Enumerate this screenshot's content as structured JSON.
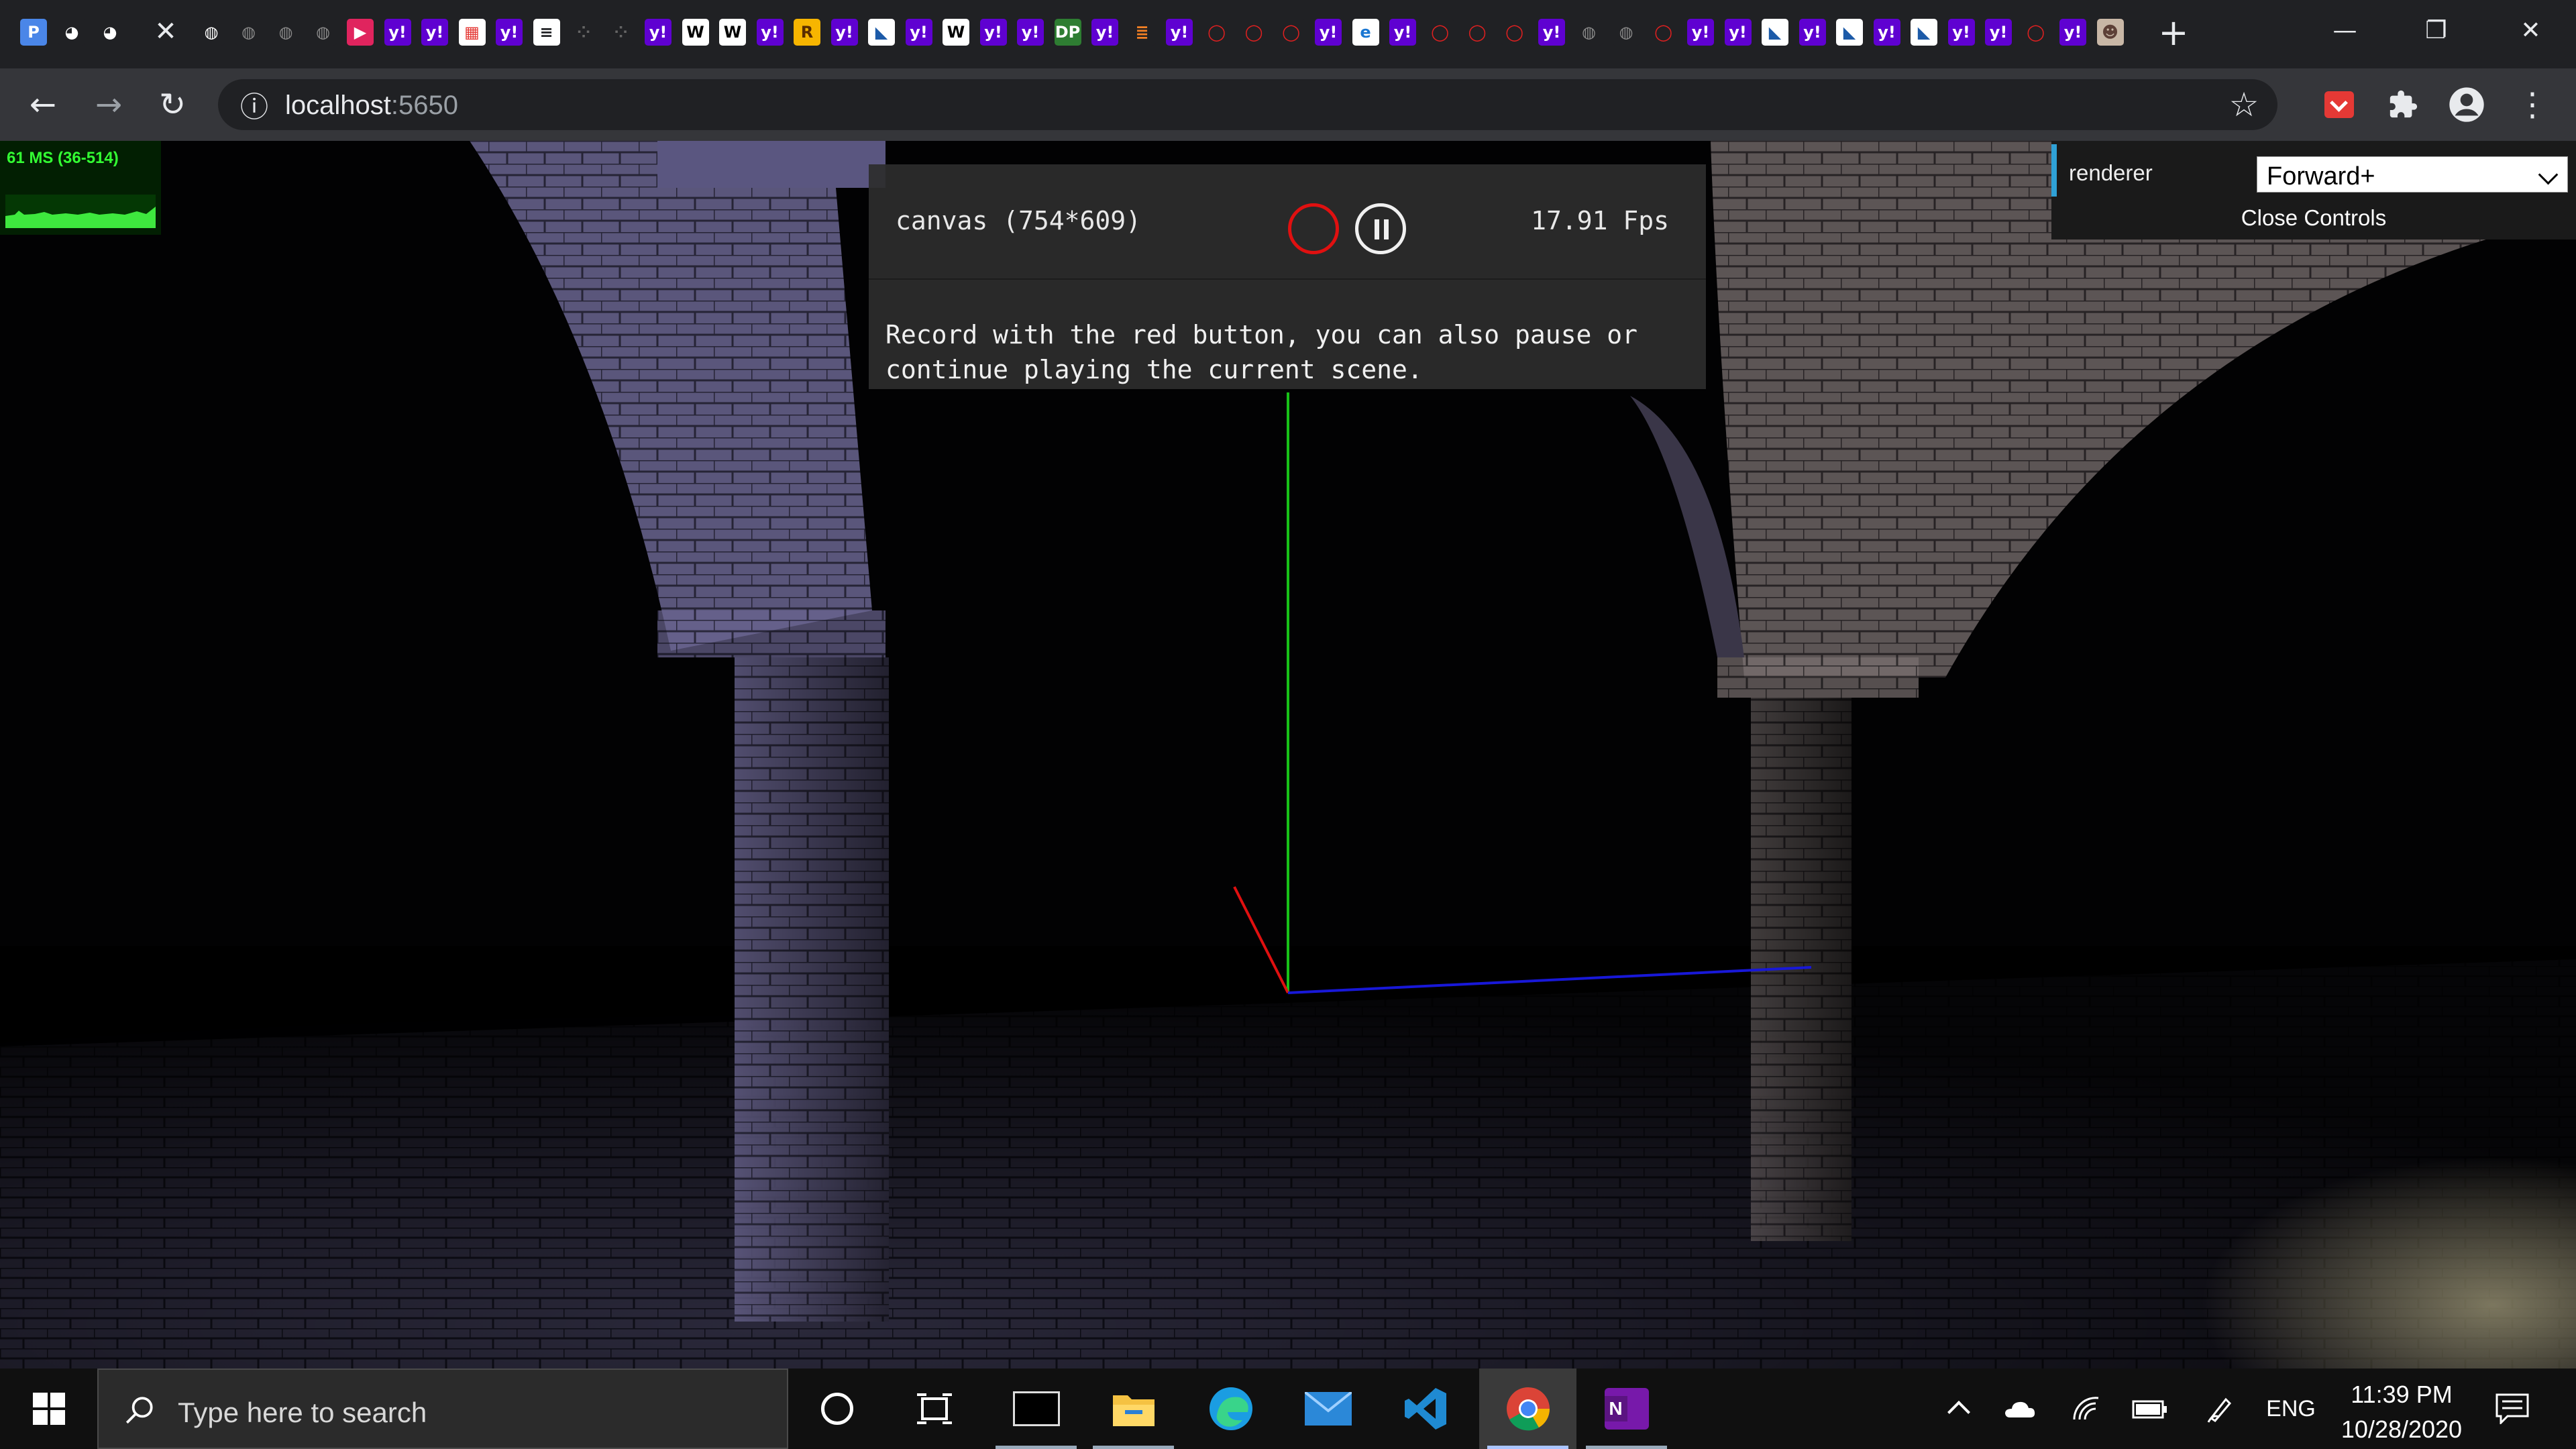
{
  "browser": {
    "tab_close_glyph": "✕",
    "newtab_glyph": "+",
    "window": {
      "minimize": "—",
      "restore": "❐",
      "close": "✕"
    },
    "favicons": [
      {
        "name": "p-icon",
        "glyph": "P",
        "bg": "#4a86e8",
        "fg": "#fff"
      },
      {
        "name": "github-icon",
        "glyph": "◕",
        "bg": "#202124",
        "fg": "#fff"
      },
      {
        "name": "github-icon",
        "glyph": "◕",
        "bg": "#202124",
        "fg": "#fff"
      },
      {
        "name": "globe-icon",
        "glyph": "◍",
        "bg": "#202124",
        "fg": "#fff"
      },
      {
        "name": "globe-icon",
        "glyph": "◍",
        "bg": "#202124",
        "fg": "#8a8a8a"
      },
      {
        "name": "globe-icon",
        "glyph": "◍",
        "bg": "#202124",
        "fg": "#8a8a8a"
      },
      {
        "name": "globe-icon",
        "glyph": "◍",
        "bg": "#202124",
        "fg": "#8a8a8a"
      },
      {
        "name": "play-icon",
        "glyph": "▶",
        "bg": "#e0245e",
        "fg": "#fff"
      },
      {
        "name": "yahoo-icon",
        "glyph": "y!",
        "bg": "#5f01d1",
        "fg": "#fff"
      },
      {
        "name": "yahoo-icon",
        "glyph": "y!",
        "bg": "#5f01d1",
        "fg": "#fff"
      },
      {
        "name": "colorful-icon",
        "glyph": "▦",
        "bg": "#ffffff",
        "fg": "#e53935"
      },
      {
        "name": "yahoo-icon",
        "glyph": "y!",
        "bg": "#5f01d1",
        "fg": "#fff"
      },
      {
        "name": "document-icon",
        "glyph": "≡",
        "bg": "#ffffff",
        "fg": "#202124"
      },
      {
        "name": "dots-icon",
        "glyph": "⁘",
        "bg": "#202124",
        "fg": "#666"
      },
      {
        "name": "dots-icon",
        "glyph": "⁘",
        "bg": "#202124",
        "fg": "#666"
      },
      {
        "name": "yahoo-icon",
        "glyph": "y!",
        "bg": "#5f01d1",
        "fg": "#fff"
      },
      {
        "name": "wikipedia-icon",
        "glyph": "W",
        "bg": "#ffffff",
        "fg": "#000"
      },
      {
        "name": "wikipedia-icon",
        "glyph": "W",
        "bg": "#ffffff",
        "fg": "#000"
      },
      {
        "name": "yahoo-icon",
        "glyph": "y!",
        "bg": "#5f01d1",
        "fg": "#fff"
      },
      {
        "name": "r-icon",
        "glyph": "R",
        "bg": "#f7b500",
        "fg": "#5a2d00"
      },
      {
        "name": "yahoo-icon",
        "glyph": "y!",
        "bg": "#5f01d1",
        "fg": "#fff"
      },
      {
        "name": "bird-icon",
        "glyph": "◣",
        "bg": "#ffffff",
        "fg": "#1c5aa8"
      },
      {
        "name": "yahoo-icon",
        "glyph": "y!",
        "bg": "#5f01d1",
        "fg": "#fff"
      },
      {
        "name": "wikipedia-icon",
        "glyph": "W",
        "bg": "#ffffff",
        "fg": "#000"
      },
      {
        "name": "yahoo-icon",
        "glyph": "y!",
        "bg": "#5f01d1",
        "fg": "#fff"
      },
      {
        "name": "yahoo-icon",
        "glyph": "y!",
        "bg": "#5f01d1",
        "fg": "#fff"
      },
      {
        "name": "dp-icon",
        "glyph": "DP",
        "bg": "#2e7d32",
        "fg": "#fff"
      },
      {
        "name": "yahoo-icon",
        "glyph": "y!",
        "bg": "#5f01d1",
        "fg": "#fff"
      },
      {
        "name": "stackoverflow-icon",
        "glyph": "≣",
        "bg": "#202124",
        "fg": "#f48024"
      },
      {
        "name": "yahoo-icon",
        "glyph": "y!",
        "bg": "#5f01d1",
        "fg": "#fff"
      },
      {
        "name": "opera-icon",
        "glyph": "◯",
        "bg": "#202124",
        "fg": "#e02020"
      },
      {
        "name": "opera-icon",
        "glyph": "◯",
        "bg": "#202124",
        "fg": "#e02020"
      },
      {
        "name": "opera-icon",
        "glyph": "◯",
        "bg": "#202124",
        "fg": "#e02020"
      },
      {
        "name": "yahoo-icon",
        "glyph": "y!",
        "bg": "#5f01d1",
        "fg": "#fff"
      },
      {
        "name": "ie-icon",
        "glyph": "e",
        "bg": "#ffffff",
        "fg": "#1976d2"
      },
      {
        "name": "yahoo-icon",
        "glyph": "y!",
        "bg": "#5f01d1",
        "fg": "#fff"
      },
      {
        "name": "opera-icon",
        "glyph": "◯",
        "bg": "#202124",
        "fg": "#e02020"
      },
      {
        "name": "opera-icon",
        "glyph": "◯",
        "bg": "#202124",
        "fg": "#e02020"
      },
      {
        "name": "opera-icon",
        "glyph": "◯",
        "bg": "#202124",
        "fg": "#e02020"
      },
      {
        "name": "yahoo-icon",
        "glyph": "y!",
        "bg": "#5f01d1",
        "fg": "#fff"
      },
      {
        "name": "globe-icon",
        "glyph": "◍",
        "bg": "#202124",
        "fg": "#8a8a8a"
      },
      {
        "name": "globe-icon",
        "glyph": "◍",
        "bg": "#202124",
        "fg": "#8a8a8a"
      },
      {
        "name": "opera-icon",
        "glyph": "◯",
        "bg": "#202124",
        "fg": "#e02020"
      },
      {
        "name": "yahoo-icon",
        "glyph": "y!",
        "bg": "#5f01d1",
        "fg": "#fff"
      },
      {
        "name": "yahoo-icon",
        "glyph": "y!",
        "bg": "#5f01d1",
        "fg": "#fff"
      },
      {
        "name": "bird-icon",
        "glyph": "◣",
        "bg": "#ffffff",
        "fg": "#1c5aa8"
      },
      {
        "name": "yahoo-icon",
        "glyph": "y!",
        "bg": "#5f01d1",
        "fg": "#fff"
      },
      {
        "name": "bird-icon",
        "glyph": "◣",
        "bg": "#ffffff",
        "fg": "#1c5aa8"
      },
      {
        "name": "yahoo-icon",
        "glyph": "y!",
        "bg": "#5f01d1",
        "fg": "#fff"
      },
      {
        "name": "bird-icon",
        "glyph": "◣",
        "bg": "#ffffff",
        "fg": "#1c5aa8"
      },
      {
        "name": "yahoo-icon",
        "glyph": "y!",
        "bg": "#5f01d1",
        "fg": "#fff"
      },
      {
        "name": "yahoo-icon",
        "glyph": "y!",
        "bg": "#5f01d1",
        "fg": "#fff"
      },
      {
        "name": "opera-icon",
        "glyph": "◯",
        "bg": "#202124",
        "fg": "#e02020"
      },
      {
        "name": "yahoo-icon",
        "glyph": "y!",
        "bg": "#5f01d1",
        "fg": "#fff"
      },
      {
        "name": "profile-photo-icon",
        "glyph": "☻",
        "bg": "#c8b7a6",
        "fg": "#5d4037"
      }
    ],
    "back_glyph": "←",
    "forward_glyph": "→",
    "reload_glyph": "↻",
    "info_glyph": "ⓘ",
    "url_host": "localhost",
    "url_port": ":5650",
    "star_glyph": "☆",
    "menu_glyph": "⋮"
  },
  "stats": {
    "text": "61 MS (36-514)",
    "color": "#33ff33"
  },
  "hud": {
    "title": "canvas (754*609)",
    "fps": "17.91 Fps",
    "help": "Record with the red button, you can also pause or continue playing the current scene.",
    "record_color": "#e01010"
  },
  "controls": {
    "renderer_label": "renderer",
    "renderer_value": "Forward+",
    "close_label": "Close Controls"
  },
  "taskbar": {
    "search_placeholder": "Type here to search",
    "language": "ENG",
    "time": "11:39 PM",
    "date": "10/28/2020"
  }
}
